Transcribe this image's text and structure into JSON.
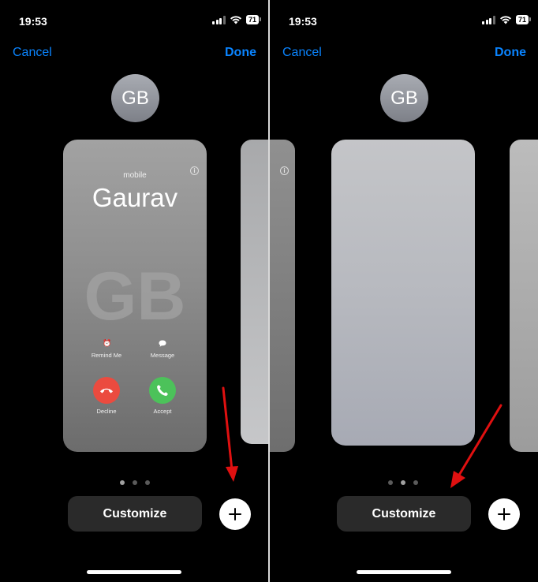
{
  "status": {
    "time": "19:53",
    "battery": "71"
  },
  "nav": {
    "cancel": "Cancel",
    "done": "Done"
  },
  "avatar": {
    "initials": "GB"
  },
  "poster": {
    "label": "mobile",
    "name": "Gaurav",
    "monogram": "GB",
    "remind": "Remind Me",
    "message": "Message",
    "decline": "Decline",
    "accept": "Accept"
  },
  "customize_label": "Customize",
  "colors": {
    "link": "#0a84ff",
    "decline": "#eb4b3f",
    "accept": "#4cc25a",
    "annotation_arrow": "#e01010"
  },
  "icons": [
    "signal-icon",
    "wifi-icon",
    "battery-icon",
    "info-icon",
    "alarm-icon",
    "message-icon",
    "phone-decline-icon",
    "phone-accept-icon",
    "plus-icon",
    "red-arrow-icon"
  ]
}
